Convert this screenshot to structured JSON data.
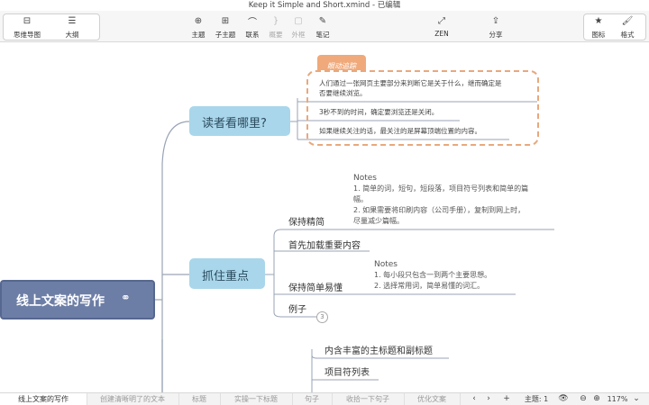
{
  "window": {
    "title": "Keep it Simple and Short.xmind - 已编辑"
  },
  "toolbar": {
    "view_mindmap": "思维导图",
    "view_outline": "大纲",
    "topic": "主题",
    "subtopic": "子主题",
    "relationship": "联系",
    "summary": "概要",
    "boundary": "外框",
    "note": "笔记",
    "zen": "ZEN",
    "share": "分享",
    "icon": "图标",
    "format": "格式"
  },
  "map": {
    "central": "线上文案的写作",
    "branch1": {
      "label": "读者看哪里?",
      "callout_tag": "眼动追踪",
      "items": [
        "人们通过一张网页主要部分来判断它是关于什么，继而确定是",
        "否要继续浏览。",
        "3秒不到的时间，确定要浏览还是关闭。",
        "如果继续关注的话，最关注的是屏幕顶端位置的内容。"
      ]
    },
    "branch2": {
      "label": "抓住重点",
      "sub1": "保持精简",
      "sub1_note": [
        "Notes",
        "1. 简单的词，短句，短段落，项目符号列表和简单的篇",
        "幅。",
        "2. 如果需要将印刷内容（公司手册），复制到网上时，",
        "尽量减少篇幅。"
      ],
      "sub2": "首先加载重要内容",
      "sub3": "保持简单易懂",
      "sub3_note": [
        "Notes",
        "1. 每小段只包含一到两个主要思想。",
        "2. 选择常用词，简单易懂的词汇。"
      ],
      "sub4": "例子",
      "sub4_badge": "3"
    },
    "branch3": {
      "items": [
        "内含丰富的主标题和副标题",
        "项目符列表"
      ]
    }
  },
  "statusbar": {
    "sheets": [
      "线上文案的写作",
      "创建清晰明了的文本",
      "标题",
      "实操一下标题",
      "句子",
      "收拾一下句子",
      "优化文案"
    ],
    "topic_count": "主题: 1",
    "zoom": "117%"
  },
  "colors": {
    "central_fill": "#6d7ea6",
    "branch_fill": "#a9d6ea",
    "callout_border": "#e8a87c",
    "callout_tag": "#f0a97a",
    "line": "#9aa3b4"
  }
}
